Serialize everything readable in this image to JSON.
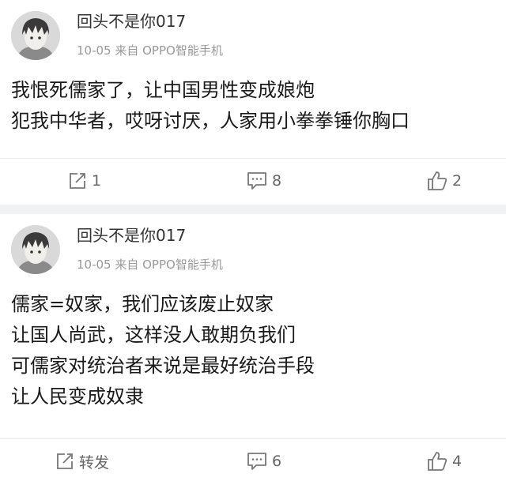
{
  "posts": [
    {
      "username": "回头不是你017",
      "meta": "10-05 来自 OPPO智能手机",
      "lines": [
        "我恨死儒家了，让中国男性变成娘炮",
        "犯我中华者，哎呀讨厌，人家用小拳拳锤你胸口"
      ],
      "repost": "1",
      "comments": "8",
      "likes": "2"
    },
    {
      "username": "回头不是你017",
      "meta": "10-05 来自 OPPO智能手机",
      "lines": [
        "儒家=奴家，我们应该废止奴家",
        "让国人尚武，这样没人敢期负我们",
        "可儒家对统治者来说是最好统治手段",
        "让人民变成奴隶"
      ],
      "repost": "转发",
      "comments": "6",
      "likes": "4"
    }
  ],
  "colors": {
    "text": "#1a1a1a",
    "meta": "#999999",
    "action": "#666666",
    "divider": "#f1f2f4"
  },
  "icons": [
    "avatar",
    "repost-icon",
    "comment-icon",
    "like-icon"
  ]
}
